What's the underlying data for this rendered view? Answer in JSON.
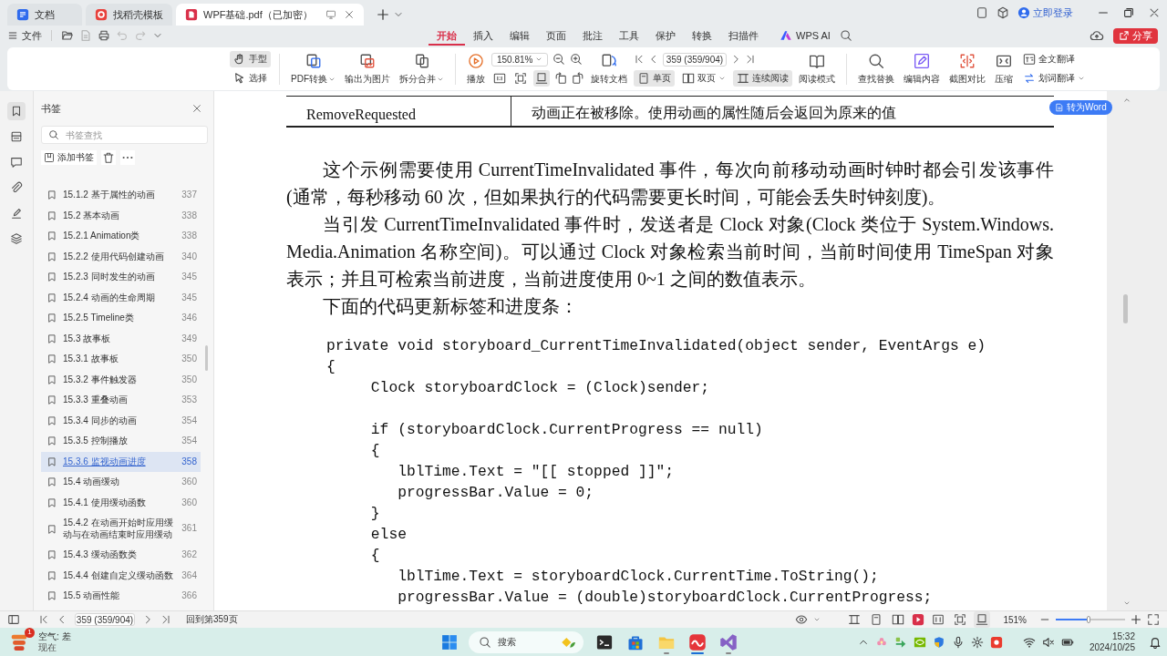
{
  "title_bar": {
    "tabs": [
      {
        "label": "文档",
        "selected": false
      },
      {
        "label": "找稻壳模板",
        "selected": false
      },
      {
        "label": "WPF基础.pdf（已加密）",
        "selected": true
      }
    ],
    "login": "立即登录"
  },
  "menu": {
    "file": "文件",
    "tabs": [
      {
        "label": "开始",
        "selected": true
      },
      {
        "label": "插入",
        "selected": false
      },
      {
        "label": "编辑",
        "selected": false
      },
      {
        "label": "页面",
        "selected": false
      },
      {
        "label": "批注",
        "selected": false
      },
      {
        "label": "工具",
        "selected": false
      },
      {
        "label": "保护",
        "selected": false
      },
      {
        "label": "转换",
        "selected": false
      },
      {
        "label": "扫描件",
        "selected": false
      }
    ],
    "ai": "WPS AI",
    "share": "分享"
  },
  "toolbar": {
    "pointer_tools": [
      {
        "label": "手型",
        "selected": true
      },
      {
        "label": "选择",
        "selected": false
      }
    ],
    "export_tools": [
      {
        "label": "PDF转换",
        "dropdown": true
      },
      {
        "label": "输出为图片",
        "dropdown": false
      },
      {
        "label": "拆分合并",
        "dropdown": true
      }
    ],
    "play": "播放",
    "zoom": "150.81%",
    "fit_modes": [
      {
        "selected": false
      },
      {
        "selected": false
      },
      {
        "selected": true
      }
    ],
    "rotate": "旋转文档",
    "page": "359 (359/904)",
    "view_modes": [
      {
        "label": "单页",
        "selected": true,
        "dropdown": false
      },
      {
        "label": "双页",
        "selected": false,
        "dropdown": true
      },
      {
        "label": "连续阅读",
        "selected": true,
        "dropdown": false
      }
    ],
    "read_mode": "阅读模式",
    "edit_tools": [
      {
        "label": "查找替换"
      },
      {
        "label": "编辑内容"
      },
      {
        "label": "截图对比"
      },
      {
        "label": "压缩"
      }
    ],
    "translate": [
      {
        "label": "全文翻译",
        "dropdown": false
      },
      {
        "label": "划词翻译",
        "dropdown": true
      }
    ]
  },
  "sidebar": {
    "rail": [
      {
        "selected": true
      },
      {
        "selected": false
      },
      {
        "selected": false
      },
      {
        "selected": false
      },
      {
        "selected": false
      },
      {
        "selected": false
      }
    ],
    "title": "书签",
    "search": {
      "placeholder": "书签查找"
    },
    "add": "添加书签",
    "bookmarks": [
      {
        "label": "15.1.2 基于属性的动画",
        "page": "337",
        "selected": false
      },
      {
        "label": "15.2 基本动画",
        "page": "338",
        "selected": false
      },
      {
        "label": "15.2.1 Animation类",
        "page": "338",
        "selected": false
      },
      {
        "label": "15.2.2 使用代码创建动画",
        "page": "340",
        "selected": false
      },
      {
        "label": "15.2.3 同时发生的动画",
        "page": "345",
        "selected": false
      },
      {
        "label": "15.2.4 动画的生命周期",
        "page": "345",
        "selected": false
      },
      {
        "label": "15.2.5 Timeline类",
        "page": "346",
        "selected": false
      },
      {
        "label": "15.3 故事板",
        "page": "349",
        "selected": false
      },
      {
        "label": "15.3.1 故事板",
        "page": "350",
        "selected": false
      },
      {
        "label": "15.3.2 事件触发器",
        "page": "350",
        "selected": false
      },
      {
        "label": "15.3.3 重叠动画",
        "page": "353",
        "selected": false
      },
      {
        "label": "15.3.4 同步的动画",
        "page": "354",
        "selected": false
      },
      {
        "label": "15.3.5 控制播放",
        "page": "354",
        "selected": false
      },
      {
        "label": "15.3.6 监视动画进度",
        "page": "358",
        "selected": true
      },
      {
        "label": "15.4 动画缓动",
        "page": "360",
        "selected": false
      },
      {
        "label": "15.4.1 使用缓动函数",
        "page": "360",
        "selected": false
      },
      {
        "label": "15.4.2 在动画开始时应用缓动与在动画结束时应用缓动",
        "page": "361",
        "selected": false
      },
      {
        "label": "15.4.3 缓动函数类",
        "page": "362",
        "selected": false
      },
      {
        "label": "15.4.4 创建自定义缓动函数",
        "page": "364",
        "selected": false
      },
      {
        "label": "15.5 动画性能",
        "page": "366",
        "selected": false
      }
    ]
  },
  "document": {
    "table_row": [
      "RemoveRequested",
      "动画正在被移除。使用动画的属性随后会返回为原来的值"
    ],
    "paragraphs": [
      "这个示例需要使用 CurrentTimeInvalidated 事件，每次向前移动动画时钟时都会引发该事件(通常，每秒移动 60 次，但如果执行的代码需要更长时间，可能会丢失时钟刻度)。",
      "当引发 CurrentTimeInvalidated 事件时，发送者是 Clock 对象(Clock 类位于 System.Windows.Media.Animation 名称空间)。可以通过 Clock 对象检索当前时间，当前时间使用 TimeSpan 对象表示；并且可检索当前进度，当前进度使用 0~1 之间的数值表示。",
      "下面的代码更新标签和进度条："
    ],
    "code": [
      [
        "private void storyboard_CurrentTimeInvalidated(object sender, EventArgs e)",
        "{",
        "     Clock storyboardClock = (Clock)sender;"
      ],
      [
        "     if (storyboardClock.CurrentProgress == null)",
        "     {",
        "        lblTime.Text = \"[[ stopped ]]\";",
        "        progressBar.Value = 0;",
        "     }",
        "     else",
        "     {",
        "        lblTime.Text = storyboardClock.CurrentTime.ToString();",
        "        progressBar.Value = (double)storyboardClock.CurrentProgress;"
      ]
    ],
    "convert_button": "转为Word"
  },
  "status_bar": {
    "page": "359 (359/904)",
    "back": "回到第359页",
    "layout_modes": [
      {
        "selected": false
      },
      {
        "selected": false
      },
      {
        "selected": false
      }
    ],
    "fit_modes": [
      {
        "selected": false
      },
      {
        "selected": false
      },
      {
        "selected": true
      }
    ],
    "zoom": "151%",
    "zoom_slider": {
      "level": 0.48
    }
  },
  "taskbar": {
    "weather": {
      "badge": "1",
      "title": "空气: 差",
      "subtitle": "现在"
    },
    "search": {
      "placeholder": "搜索"
    },
    "apps": [
      {
        "running": false,
        "selected": false
      },
      {
        "running": false,
        "selected": false
      },
      {
        "running": true,
        "selected": false
      },
      {
        "running": true,
        "selected": true
      },
      {
        "running": true,
        "selected": false
      }
    ],
    "time": "15:32",
    "date": "2024/10/25"
  }
}
